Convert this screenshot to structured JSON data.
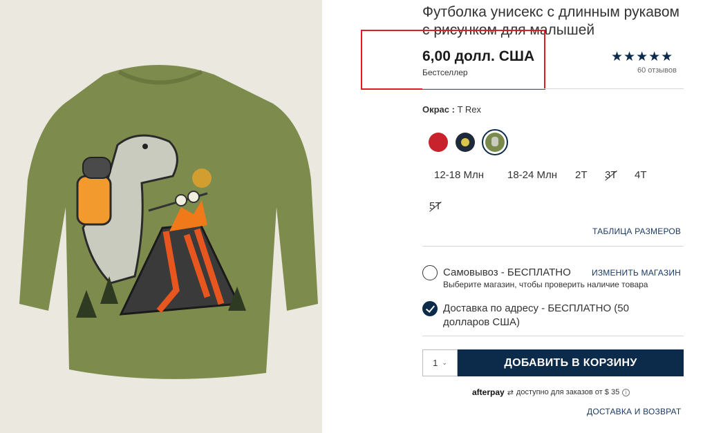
{
  "product": {
    "title": "Футболка унисекс с длинным рукавом с рисунком для малышей",
    "price": "6,00 долл. США",
    "badge": "Бестселлер",
    "rating_stars": "★★★★★",
    "rating": 5,
    "reviews": "60 отзывов"
  },
  "color": {
    "label": "Окрас :",
    "value": "T Rex",
    "swatches": [
      {
        "name": "red-graphic",
        "color": "#c8232c"
      },
      {
        "name": "navy-graphic",
        "color": "#1e2a3a"
      },
      {
        "name": "t-rex",
        "color": "#7a8a4a",
        "selected": true
      }
    ]
  },
  "sizes": [
    {
      "label": "12-18 Mлн",
      "available": true
    },
    {
      "label": "18-24 Mлн",
      "available": true
    },
    {
      "label": "2T",
      "available": true
    },
    {
      "label": "3T",
      "available": false
    },
    {
      "label": "4T",
      "available": true
    },
    {
      "label": "5T",
      "available": false
    }
  ],
  "size_chart_link": "ТАБЛИЦА РАЗМЕРОВ",
  "fulfillment": {
    "pickup_label": "Самовывоз - БЕСПЛАТНО",
    "change_store": "ИЗМЕНИТЬ МАГАЗИН",
    "pickup_sub": "Выберите магазин, чтобы проверить наличие товара",
    "delivery_label": "Доставка по адресу - БЕСПЛАТНО (50 долларов США)",
    "delivery_selected": true
  },
  "cart": {
    "quantity": "1",
    "add_button": "ДОБАВИТЬ В КОРЗИНУ"
  },
  "afterpay": {
    "brand": "afterpay",
    "text": "доступно для заказов от $ 35"
  },
  "shipping_link": "ДОСТАВКА И ВОЗВРАТ",
  "colors": {
    "accent": "#0c2b4a",
    "highlight": "#e01b22",
    "shirt": "#7d8b4c"
  }
}
